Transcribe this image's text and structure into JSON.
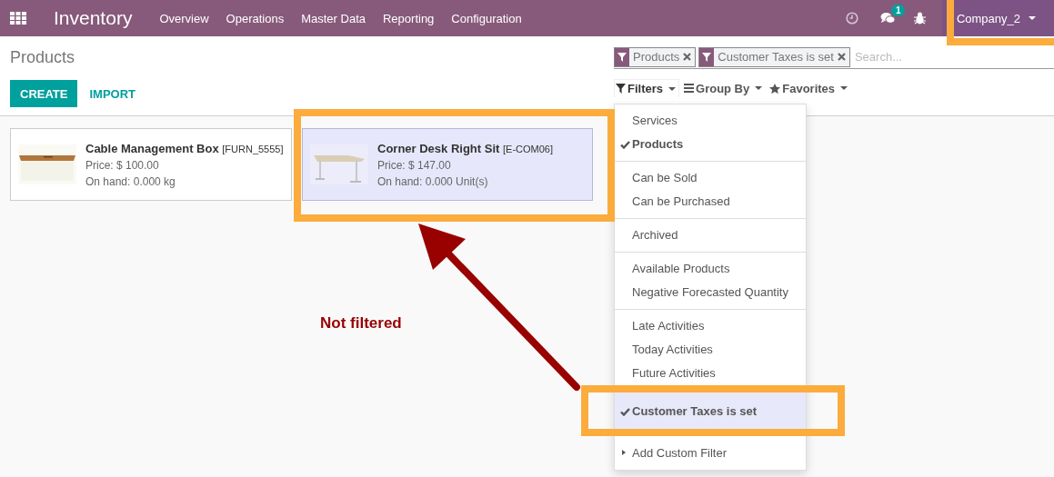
{
  "navbar": {
    "app_title": "Inventory",
    "menu": [
      "Overview",
      "Operations",
      "Master Data",
      "Reporting",
      "Configuration"
    ],
    "message_count": "1",
    "company": "Company_2",
    "company_highlighted": true
  },
  "breadcrumb": "Products",
  "buttons": {
    "create": "CREATE",
    "import": "IMPORT"
  },
  "search": {
    "facets": [
      {
        "label": "Products"
      },
      {
        "label": "Customer Taxes is set"
      }
    ],
    "placeholder": "Search..."
  },
  "search_options": [
    {
      "label": "Filters",
      "kind": "filter",
      "selected": true
    },
    {
      "label": "Group By",
      "kind": "group",
      "selected": false
    },
    {
      "label": "Favorites",
      "kind": "star",
      "selected": false
    }
  ],
  "filter_menu": {
    "groups": [
      [
        {
          "label": "Services",
          "checked": false,
          "highlighted": false
        },
        {
          "label": "Products",
          "checked": true,
          "highlighted": false
        }
      ],
      [
        {
          "label": "Can be Sold",
          "checked": false,
          "highlighted": false
        },
        {
          "label": "Can be Purchased",
          "checked": false,
          "highlighted": false
        }
      ],
      [
        {
          "label": "Archived",
          "checked": false,
          "highlighted": false
        }
      ],
      [
        {
          "label": "Available Products",
          "checked": false,
          "highlighted": false
        },
        {
          "label": "Negative Forecasted Quantity",
          "checked": false,
          "highlighted": false
        }
      ],
      [
        {
          "label": "Late Activities",
          "checked": false,
          "highlighted": false
        },
        {
          "label": "Today Activities",
          "checked": false,
          "highlighted": false
        },
        {
          "label": "Future Activities",
          "checked": false,
          "highlighted": false
        }
      ],
      [
        {
          "label": "Customer Taxes is set",
          "checked": true,
          "highlighted": true
        }
      ]
    ],
    "custom_filter": "Add Custom Filter"
  },
  "cards": [
    {
      "name": "Cable Management Box",
      "code": "[FURN_5555]",
      "price": "Price: $ 100.00",
      "on_hand": "On hand: 0.000 kg",
      "highlighted": false
    },
    {
      "name": "Corner Desk Right Sit",
      "code": "[E-COM06]",
      "price": "Price: $ 147.00",
      "on_hand": "On hand: 0.000 Unit(s)",
      "highlighted": true
    }
  ],
  "annotation": {
    "text": "Not filtered"
  }
}
